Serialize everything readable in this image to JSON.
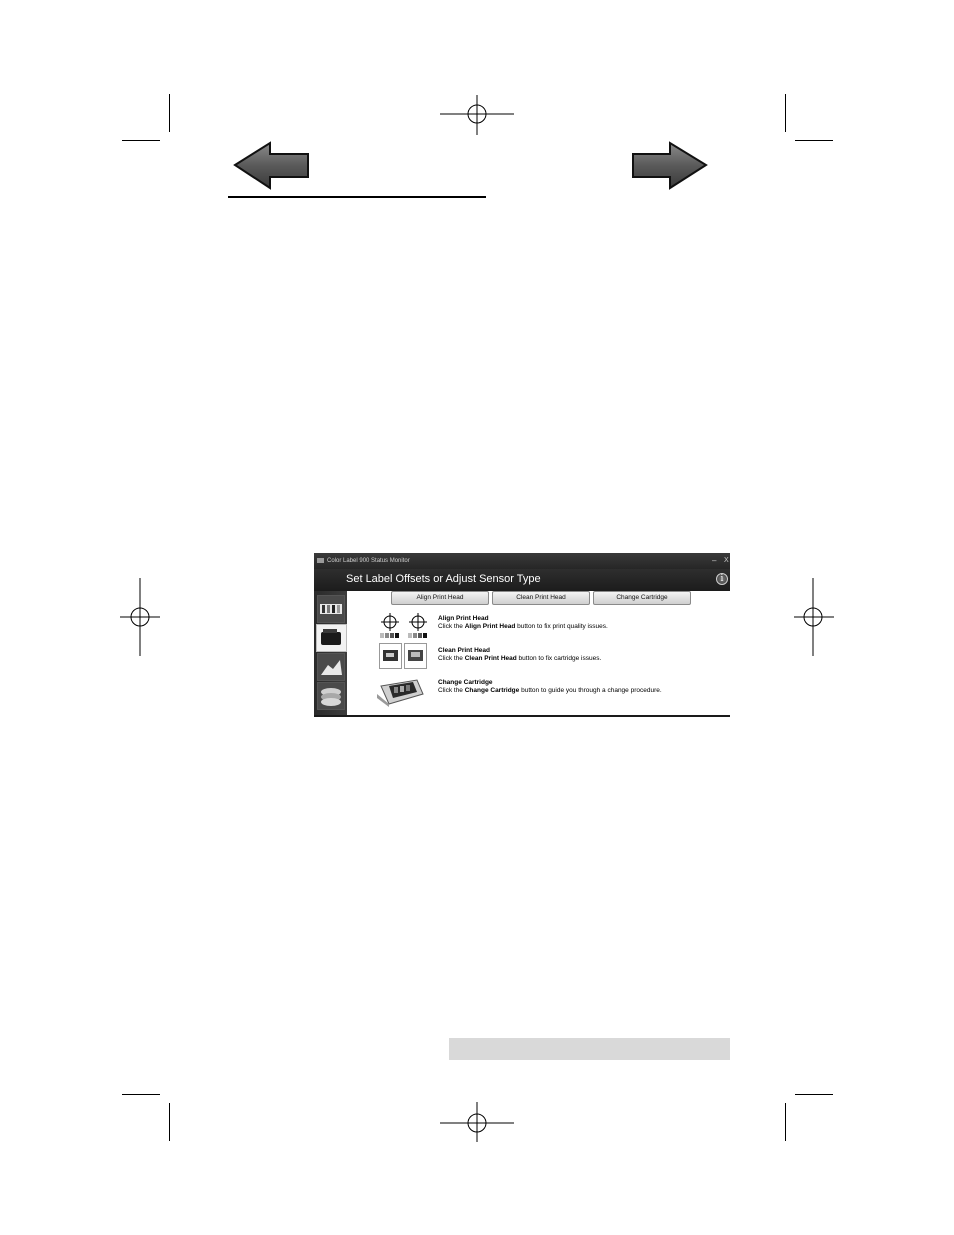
{
  "window": {
    "title": "Color Label 900 Status Monitor",
    "minimize_glyph": "–",
    "close_glyph": "X"
  },
  "page": {
    "title": "Set Label Offsets or Adjust Sensor Type",
    "info_glyph": "i"
  },
  "toolbar": {
    "align_label": "Align Print Head",
    "clean_label": "Clean Print Head",
    "change_label": "Change Cartridge"
  },
  "sections": {
    "align": {
      "title": "Align Print Head",
      "desc_pre": "Click the ",
      "desc_bold": "Align Print Head",
      "desc_post": " button to fix print quality issues."
    },
    "clean": {
      "title": "Clean Print Head",
      "desc_pre": "Click the ",
      "desc_bold": "Clean Print Head",
      "desc_post": " button to fix cartridge issues."
    },
    "change": {
      "title": "Change Cartridge",
      "desc_pre": "Click the ",
      "desc_bold": "Change Cartridge",
      "desc_post": " button to guide you through a change procedure."
    }
  },
  "icons": {
    "back": "arrow-left-icon",
    "forward": "arrow-right-icon",
    "crosshair": "crosshair-icon",
    "cartridge": "cartridge-icon",
    "printer": "printer-icon",
    "info": "info-icon"
  },
  "colors": {
    "titlebar": "#262626",
    "button_face": "#e0e0e0",
    "footer_bar": "#d9d9d9"
  }
}
